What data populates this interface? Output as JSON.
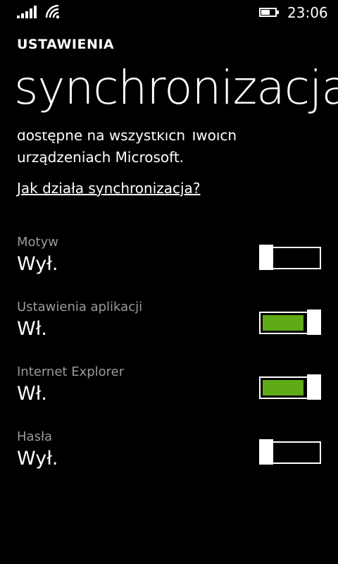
{
  "status": {
    "time": "23:06",
    "icons": [
      "signal-icon",
      "wifi-icon",
      "battery-icon"
    ]
  },
  "header": {
    "app_title": "USTAWIENIA",
    "page_title": "synchronizacja"
  },
  "description": {
    "line1_partial": "dostępne na wszystkich Twoich",
    "line2": "urządzeniach Microsoft."
  },
  "help_link": "Jak działa synchronizacja?",
  "settings": [
    {
      "label": "Motyw",
      "state": "Wył.",
      "on": false
    },
    {
      "label": "Ustawienia aplikacji",
      "state": "Wł.",
      "on": true
    },
    {
      "label": "Internet Explorer",
      "state": "Wł.",
      "on": true
    },
    {
      "label": "Hasła",
      "state": "Wył.",
      "on": false
    }
  ],
  "colors": {
    "background": "#000000",
    "accent": "#60a917",
    "label_gray": "#9a9a9a"
  }
}
